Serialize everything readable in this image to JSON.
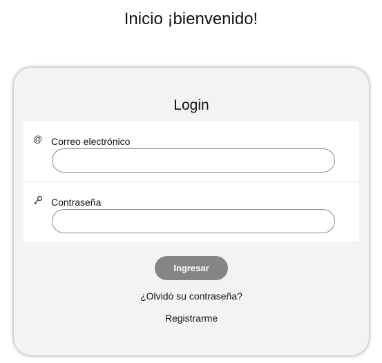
{
  "page": {
    "title": "Inicio ¡bienvenido!"
  },
  "login": {
    "title": "Login",
    "fields": [
      {
        "label": "Correo electrónico",
        "icon": "at-icon",
        "value": "",
        "placeholder": ""
      },
      {
        "label": "Contraseña",
        "icon": "key-icon",
        "value": "",
        "placeholder": ""
      }
    ],
    "submit_label": "Ingresar",
    "forgot_password_label": "¿Olvidó su contraseña?",
    "register_label": "Registrarme"
  },
  "colors": {
    "card_background": "#f3f3f3",
    "button_background": "#858585",
    "button_text": "#ffffff",
    "input_border": "#8a8a8a"
  }
}
